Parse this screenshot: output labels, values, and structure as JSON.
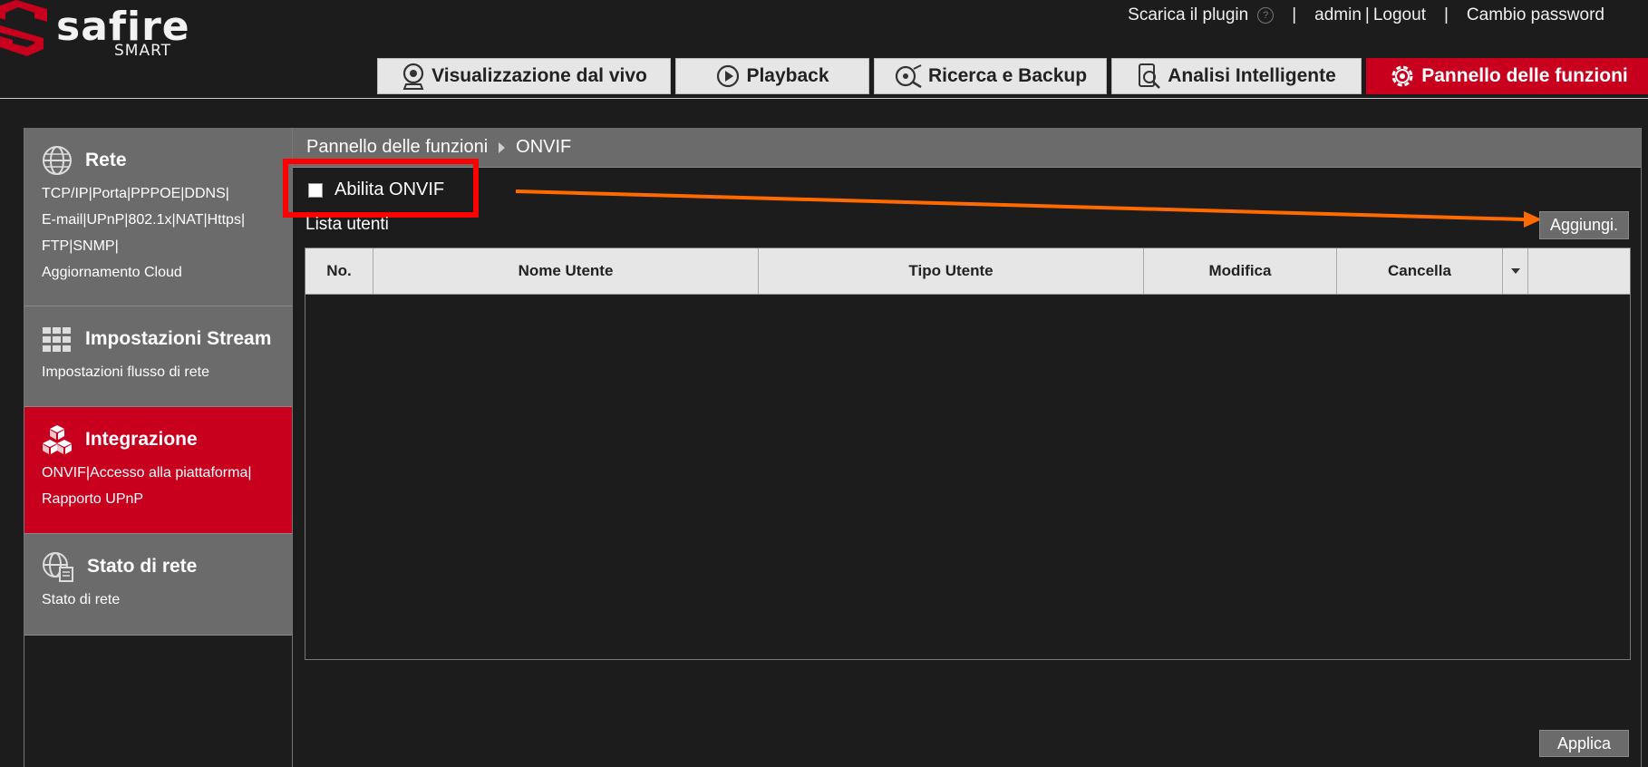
{
  "header": {
    "logo_text": "safire",
    "logo_sub": "SMART",
    "plugin_link": "Scarica il plugin",
    "separator": "|",
    "user": "admin",
    "logout": "Logout",
    "change_password": "Cambio password"
  },
  "nav": {
    "tabs": [
      {
        "label": "Visualizzazione dal vivo",
        "icon": "webcam-icon"
      },
      {
        "label": "Playback",
        "icon": "play-icon"
      },
      {
        "label": "Ricerca e Backup",
        "icon": "search-backup-icon"
      },
      {
        "label": "Analisi Intelligente",
        "icon": "analysis-icon"
      },
      {
        "label": "Pannello delle funzioni",
        "icon": "gear-icon",
        "active": true
      }
    ]
  },
  "sidebar": {
    "items": [
      {
        "title": "Rete",
        "icon": "globe-icon",
        "sub": [
          "TCP/IP|Porta|PPPOE|DDNS|",
          "E-mail|UPnP|802.1x|NAT|Https|",
          "FTP|SNMP|",
          "Aggiornamento Cloud"
        ]
      },
      {
        "title": "Impostazioni Stream",
        "icon": "grid-icon",
        "sub": [
          "Impostazioni flusso di rete"
        ]
      },
      {
        "title": "Integrazione",
        "icon": "cubes-icon",
        "active": true,
        "sub": [
          "ONVIF|Accesso alla piattaforma|",
          "Rapporto UPnP"
        ]
      },
      {
        "title": "Stato di rete",
        "icon": "network-status-icon",
        "sub": [
          "Stato di rete"
        ]
      }
    ]
  },
  "main": {
    "breadcrumb": [
      "Pannello delle funzioni",
      "ONVIF"
    ],
    "enable_label": "Abilita ONVIF",
    "enable_checked": false,
    "list_label": "Lista utenti",
    "add_button": "Aggiungi.",
    "table_headers": [
      "No.",
      "Nome Utente",
      "Tipo Utente",
      "Modifica",
      "Cancella"
    ],
    "apply_button": "Applica"
  },
  "colors": {
    "accent": "#c8001e",
    "highlight_box": "#ff0000",
    "annotation_arrow": "#ff6a00"
  }
}
